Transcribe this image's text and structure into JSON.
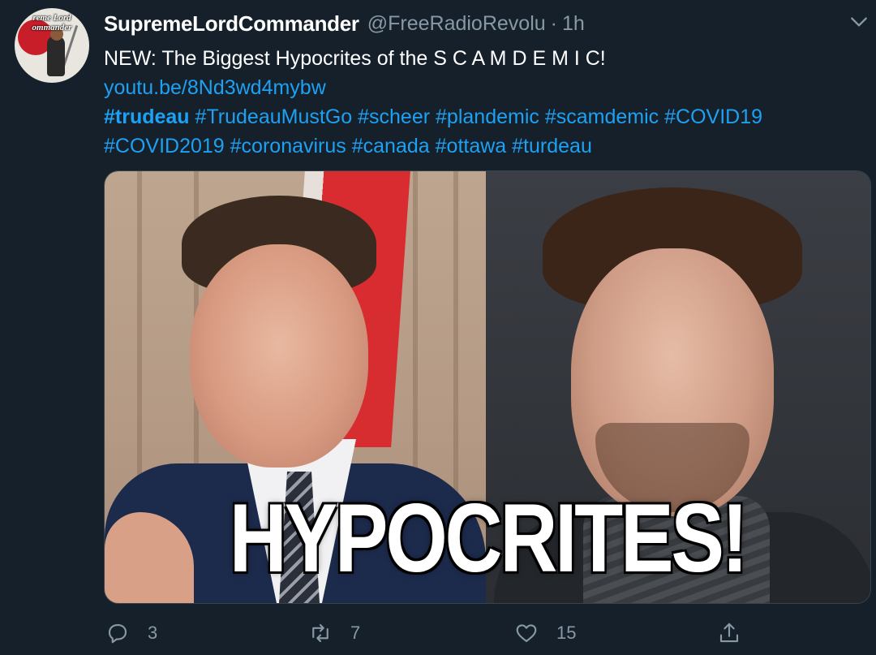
{
  "tweet": {
    "display_name": "SupremeLordCommander",
    "handle": "@FreeRadioRevolu",
    "separator": "·",
    "time": "1h",
    "avatar_text_line1": "reme Lord",
    "avatar_text_line2": "ommander",
    "text_line1": "NEW: The Biggest Hypocrites of the S C A M D E M I C!",
    "link": "youtu.be/8Nd3wd4mybw",
    "hashtags_line1": [
      "#trudeau",
      "#TrudeauMustGo",
      "#scheer",
      "#plandemic",
      "#scamdemic",
      "#COVID19"
    ],
    "hashtags_line2": [
      "#COVID2019",
      "#coronavirus",
      "#canada",
      "#ottawa",
      "#turdeau"
    ],
    "media_caption": "HYPOCRITES!",
    "reply_count": "3",
    "retweet_count": "7",
    "like_count": "15"
  },
  "icons": {
    "menu": "chevron-down-icon",
    "reply": "reply-icon",
    "retweet": "retweet-icon",
    "like": "heart-icon",
    "share": "share-icon"
  },
  "colors": {
    "background": "#15202b",
    "link": "#1da1f2",
    "secondary_text": "#8899a6"
  }
}
